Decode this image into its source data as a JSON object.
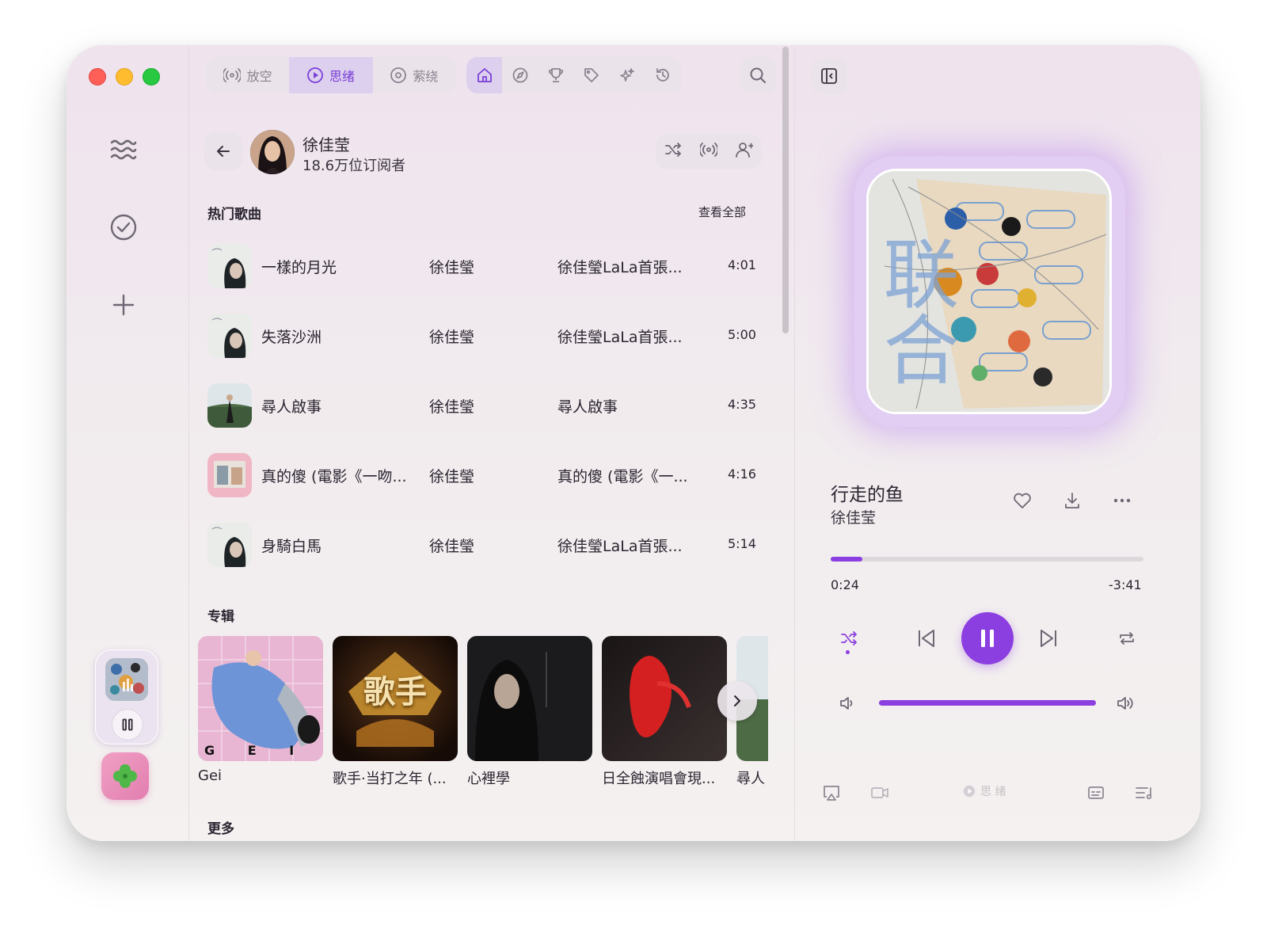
{
  "tabs": [
    "放空",
    "思绪",
    "萦绕"
  ],
  "active_tab_index": 1,
  "artist": {
    "name": "徐佳莹",
    "subscribers": "18.6万位订阅者"
  },
  "hot_songs": {
    "title": "热门歌曲",
    "see_all": "查看全部",
    "songs": [
      {
        "title": "一樣的月光",
        "artist": "徐佳瑩",
        "album": "徐佳瑩LaLa首張...",
        "duration": "4:01"
      },
      {
        "title": "失落沙洲",
        "artist": "徐佳瑩",
        "album": "徐佳瑩LaLa首張...",
        "duration": "5:00"
      },
      {
        "title": "尋人啟事",
        "artist": "徐佳瑩",
        "album": "尋人啟事",
        "duration": "4:35"
      },
      {
        "title": "真的傻 (電影《一吻...",
        "artist": "徐佳瑩",
        "album": "真的傻 (電影《一...",
        "duration": "4:16"
      },
      {
        "title": "身騎白馬",
        "artist": "徐佳瑩",
        "album": "徐佳瑩LaLa首張...",
        "duration": "5:14"
      }
    ]
  },
  "albums": {
    "title": "专辑",
    "items": [
      {
        "title": "Gei",
        "cover_text": "G  E  I"
      },
      {
        "title": "歌手·当打之年 (...",
        "cover_text": "歌手"
      },
      {
        "title": "心裡學",
        "cover_text": ""
      },
      {
        "title": "日全蝕演唱會現...",
        "cover_text": ""
      },
      {
        "title": "尋人",
        "cover_text": ""
      }
    ]
  },
  "more_title": "更多",
  "now_playing": {
    "title": "行走的鱼",
    "artist": "徐佳莹",
    "elapsed": "0:24",
    "remaining": "-3:41",
    "progress": 0.1,
    "volume": 1.0,
    "mode_label": "思 绪",
    "art_text": "联合"
  },
  "colors": {
    "accent": "#8c3fe0"
  }
}
